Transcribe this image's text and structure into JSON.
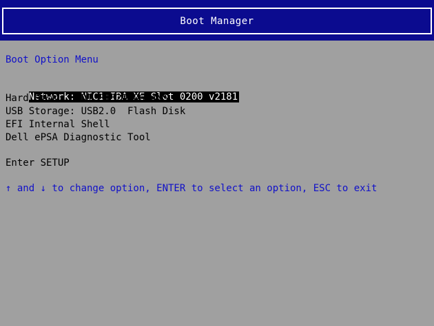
{
  "header": {
    "title": "Boot Manager"
  },
  "menu": {
    "heading": "Boot Option Menu",
    "items": [
      {
        "label": "Network: NIC1:IBA XE Slot 0200 v2181",
        "selected": true
      },
      {
        "label": "Hard Disk: HDD1:ST32000644NS",
        "selected": false
      },
      {
        "label": "USB Storage: USB2.0  Flash Disk",
        "selected": false
      },
      {
        "label": "EFI Internal Shell",
        "selected": false
      },
      {
        "label": "Dell ePSA Diagnostic Tool",
        "selected": false
      }
    ],
    "setup": "Enter SETUP"
  },
  "help": {
    "text": "↑ and ↓ to change option, ENTER to select an option, ESC to exit"
  },
  "colors": {
    "header_background": "#0b0b8f",
    "screen_background": "#a0a0a0",
    "accent_text": "#1010c8",
    "selection_background": "#000000",
    "selection_text": "#ffffff"
  }
}
